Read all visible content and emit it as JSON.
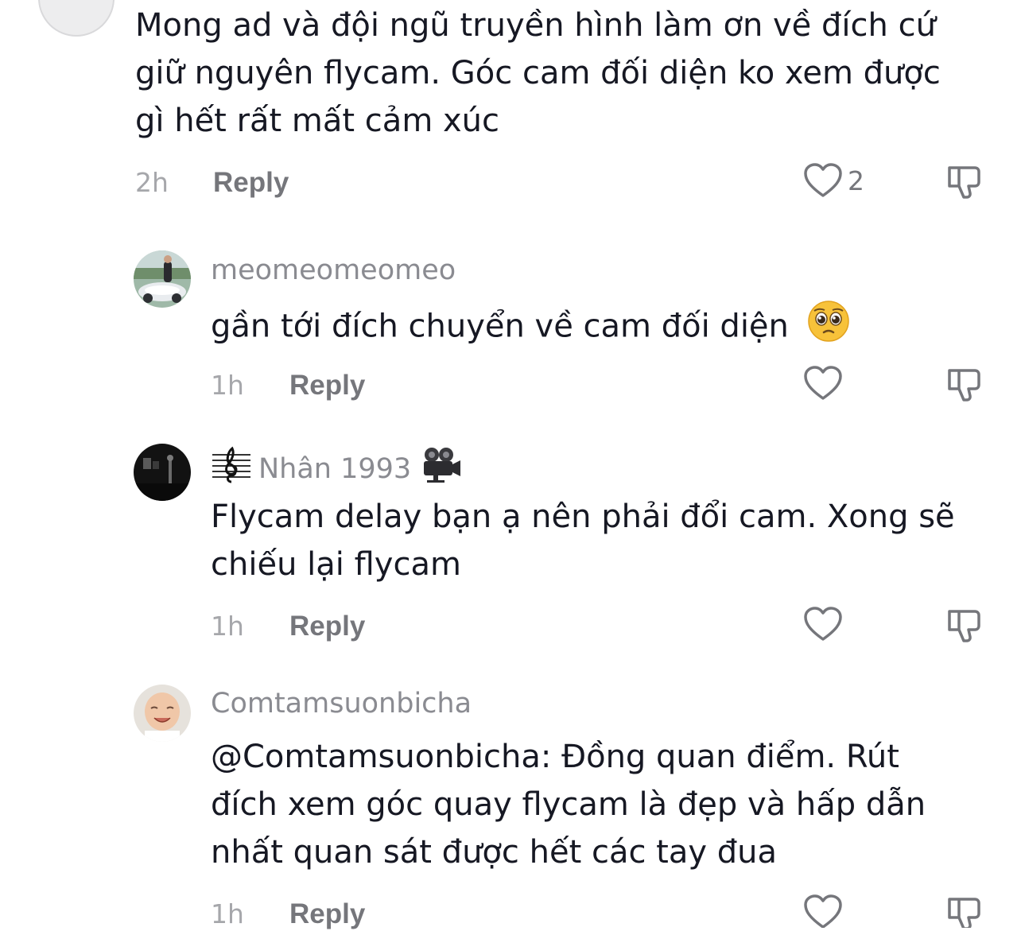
{
  "comments": [
    {
      "lines": [
        "Mong ad và đội ngũ truyền hình làm ơn về đích cứ",
        "giữ nguyên flycam. Góc cam đối diện ko xem được",
        "gì hết rất mất cảm xúc"
      ],
      "time": "2h",
      "reply_label": "Reply",
      "like_count": "2"
    },
    {
      "username": "meomeomeomeo",
      "lines": [
        "gần tới đích chuyển về cam đối diện"
      ],
      "emoji": "pleading-face",
      "time": "1h",
      "reply_label": "Reply"
    },
    {
      "username": "Nhân 1993",
      "username_prefix_icon": "music-score-icon",
      "username_suffix_icon": "movie-camera-icon",
      "lines": [
        "Flycam delay bạn ạ nên phải đổi cam. Xong sẽ",
        "chiếu lại flycam"
      ],
      "time": "1h",
      "reply_label": "Reply"
    },
    {
      "username": "Comtamsuonbicha",
      "lines": [
        "@Comtamsuonbicha: Đồng quan điểm. Rút",
        "đích xem góc quay flycam là đẹp và hấp dẫn",
        "nhất quan sát được hết các tay đua"
      ],
      "time": "1h",
      "reply_label": "Reply"
    }
  ]
}
